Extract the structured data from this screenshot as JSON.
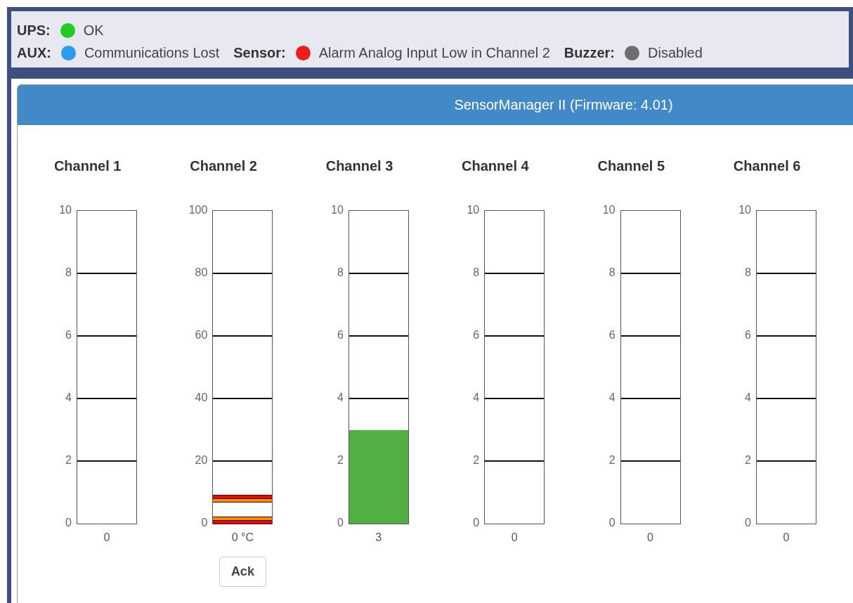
{
  "status_rows": [
    [
      {
        "label": "UPS:",
        "color": "#22cc22",
        "value": "OK"
      }
    ],
    [
      {
        "label": "AUX:",
        "color": "#2a9bf0",
        "value": "Communications Lost"
      },
      {
        "label": "Sensor:",
        "color": "#ee1c1c",
        "value": "Alarm Analog Input Low in Channel 2"
      },
      {
        "label": "Buzzer:",
        "color": "#6e6e6e",
        "value": "Disabled"
      }
    ]
  ],
  "panel": {
    "title": "SensorManager II (Firmware: 4.01)",
    "channels": [
      {
        "name": "Channel 1",
        "ticks": [
          "10",
          "8",
          "6",
          "4",
          "2",
          "0"
        ],
        "reading": "0"
      },
      {
        "name": "Channel 2",
        "ticks": [
          "100",
          "80",
          "60",
          "40",
          "20",
          "0"
        ],
        "reading": "0 °C",
        "alarm_bands": [
          {
            "level": 0.092,
            "color": "#ff0000"
          },
          {
            "level": 0.08,
            "color": "#ff8c00"
          },
          {
            "level": 0.022,
            "color": "#ff8c00"
          },
          {
            "level": 0.011,
            "color": "#ff0000"
          }
        ],
        "button": "Ack"
      },
      {
        "name": "Channel 3",
        "ticks": [
          "10",
          "8",
          "6",
          "4",
          "2",
          "0"
        ],
        "level": 0.3,
        "reading": "3"
      },
      {
        "name": "Channel 4",
        "ticks": [
          "10",
          "8",
          "6",
          "4",
          "2",
          "0"
        ],
        "reading": "0"
      },
      {
        "name": "Channel 5",
        "ticks": [
          "10",
          "8",
          "6",
          "4",
          "2",
          "0"
        ],
        "reading": "0"
      },
      {
        "name": "Channel 6",
        "ticks": [
          "10",
          "8",
          "6",
          "4",
          "2",
          "0"
        ],
        "reading": "0"
      }
    ]
  }
}
